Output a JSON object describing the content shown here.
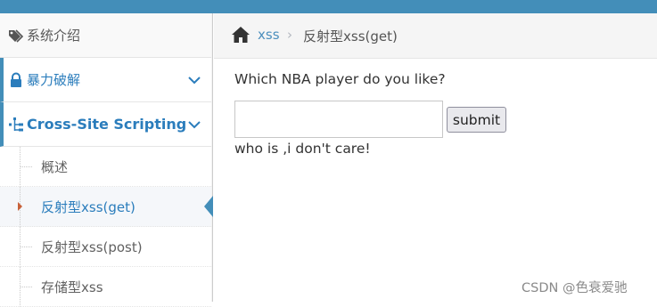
{
  "colors": {
    "accent": "#438eb9",
    "link": "#2b7dbc",
    "active_caret": "#c86139"
  },
  "sidebar": {
    "items": [
      {
        "label": "系统介绍",
        "icon": "tags-icon"
      },
      {
        "label": "暴力破解",
        "icon": "lock-icon",
        "expand": "chevron-down-icon"
      },
      {
        "label": "Cross-Site Scripting",
        "icon": "sitemap-icon",
        "expand": "chevron-down-icon"
      }
    ],
    "sub_items": [
      {
        "label": "概述"
      },
      {
        "label": "反射型xss(get)",
        "active": true
      },
      {
        "label": "反射型xss(post)"
      },
      {
        "label": "存储型xss"
      }
    ]
  },
  "breadcrumb": {
    "icon": "home-icon",
    "link": "xss",
    "separator": "›",
    "current": "反射型xss(get)"
  },
  "form": {
    "question": "Which NBA player do you like?",
    "input_value": "",
    "submit_label": "submit",
    "result": "who is ,i don't care!"
  },
  "watermark": "CSDN @色衰爱驰"
}
